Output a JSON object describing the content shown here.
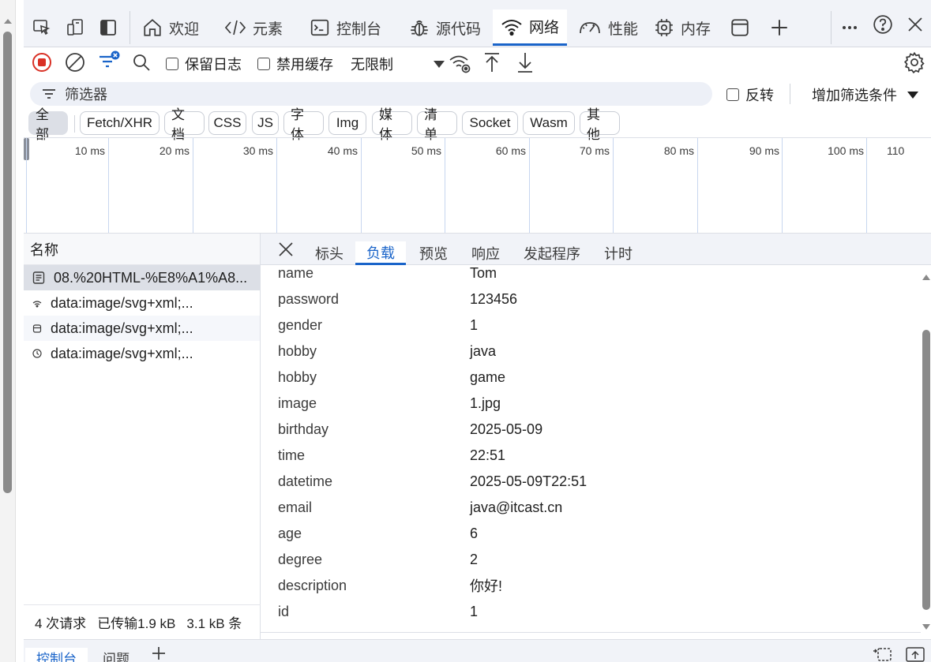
{
  "tabs": {
    "welcome": "欢迎",
    "elements": "元素",
    "console": "控制台",
    "sources": "源代码",
    "network": "网络",
    "performance": "性能",
    "memory": "内存"
  },
  "toolbar": {
    "preserve_log": "保留日志",
    "disable_cache": "禁用缓存",
    "throttle": "无限制"
  },
  "filter": {
    "placeholder": "筛选器",
    "invert": "反转",
    "more_filters": "增加筛选条件"
  },
  "types": [
    "全部",
    "Fetch/XHR",
    "文档",
    "CSS",
    "JS",
    "字体",
    "Img",
    "媒体",
    "清单",
    "Socket",
    "Wasm",
    "其他"
  ],
  "timeline": {
    "ticks": [
      "10 ms",
      "20 ms",
      "30 ms",
      "40 ms",
      "50 ms",
      "60 ms",
      "70 ms",
      "80 ms",
      "90 ms",
      "100 ms",
      "110"
    ]
  },
  "requests": {
    "header": "名称",
    "items": [
      "08.%20HTML-%E8%A1%A8...",
      "data:image/svg+xml;...",
      "data:image/svg+xml;...",
      "data:image/svg+xml;..."
    ],
    "summary": {
      "count": "4 次请求",
      "transferred": "已传输1.9 kB",
      "resources": "3.1 kB 条"
    }
  },
  "details": {
    "tabs": [
      "标头",
      "负载",
      "预览",
      "响应",
      "发起程序",
      "计时"
    ],
    "payload": [
      {
        "key": "name",
        "value": "Tom"
      },
      {
        "key": "password",
        "value": "123456"
      },
      {
        "key": "gender",
        "value": "1"
      },
      {
        "key": "hobby",
        "value": "java"
      },
      {
        "key": "hobby",
        "value": "game"
      },
      {
        "key": "image",
        "value": "1.jpg"
      },
      {
        "key": "birthday",
        "value": "2025-05-09"
      },
      {
        "key": "time",
        "value": "22:51"
      },
      {
        "key": "datetime",
        "value": "2025-05-09T22:51"
      },
      {
        "key": "email",
        "value": "java@itcast.cn"
      },
      {
        "key": "age",
        "value": "6"
      },
      {
        "key": "degree",
        "value": "2"
      },
      {
        "key": "description",
        "value": "你好!"
      },
      {
        "key": "id",
        "value": "1"
      }
    ]
  },
  "drawer": {
    "console": "控制台",
    "issues": "问题"
  },
  "colors": {
    "accent": "#1a64c9",
    "record_red": "#d93025"
  }
}
